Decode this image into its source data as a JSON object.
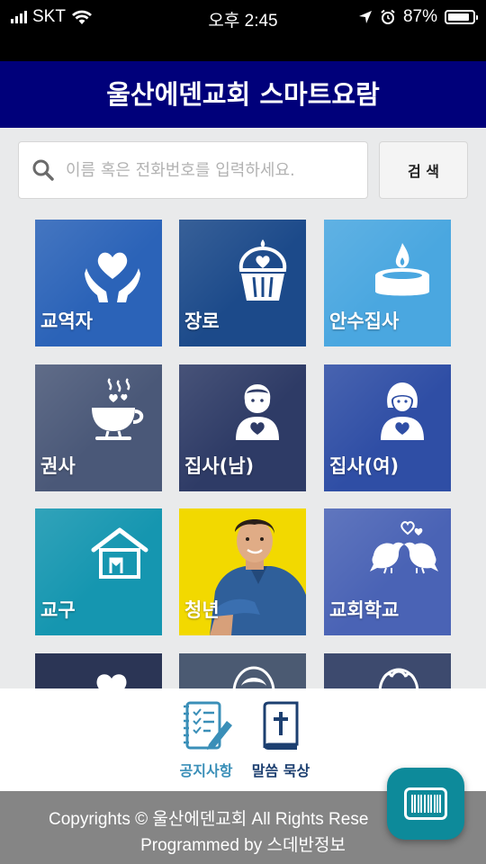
{
  "status_bar": {
    "carrier": "SKT",
    "time": "오후 2:45",
    "battery_percent": "87%",
    "battery_level": 0.87
  },
  "header": {
    "title": "울산에덴교회 스마트요람"
  },
  "search": {
    "placeholder": "이름 혹은 전화번호를 입력하세요.",
    "value": "",
    "button_label": "검 색"
  },
  "tiles": [
    {
      "label": "교역자",
      "icon": "heart-hands-icon",
      "color": "#2b63b8"
    },
    {
      "label": "장로",
      "icon": "cupcake-heart-icon",
      "color": "#1c4a8a"
    },
    {
      "label": "안수집사",
      "icon": "candle-icon",
      "color": "#4aa7e0"
    },
    {
      "label": "권사",
      "icon": "teacup-hearts-icon",
      "color": "#4a5878"
    },
    {
      "label": "집사(남)",
      "icon": "man-heart-icon",
      "color": "#2e3b66"
    },
    {
      "label": "집사(여)",
      "icon": "woman-heart-icon",
      "color": "#2f4ea5"
    },
    {
      "label": "교구",
      "icon": "house-heart-icon",
      "color": "#1596b0"
    },
    {
      "label": "청년",
      "icon": "young-man-photo",
      "color": "#f2d900"
    },
    {
      "label": "교회학교",
      "icon": "love-birds-icon",
      "color": "#4a63b5"
    },
    {
      "label": "",
      "icon": "heart-icon",
      "color": "#2b3555"
    },
    {
      "label": "",
      "icon": "child-face-icon",
      "color": "#4b5a72"
    },
    {
      "label": "",
      "icon": "angel-face-icon",
      "color": "#3d4a6e"
    }
  ],
  "dock": {
    "notice_label": "공지사항",
    "notice_icon": "clipboard-checklist-icon",
    "notice_color": "#3a8fb8",
    "devotion_label": "말씀 묵상",
    "devotion_icon": "bible-icon",
    "devotion_color": "#1c3f70"
  },
  "footer": {
    "copyright": "Copyrights © 울산에덴교회 All Rights Rese",
    "programmed": "Programmed by 스데반정보"
  },
  "fab": {
    "icon": "barcode-icon",
    "color": "#0d8a9a"
  }
}
